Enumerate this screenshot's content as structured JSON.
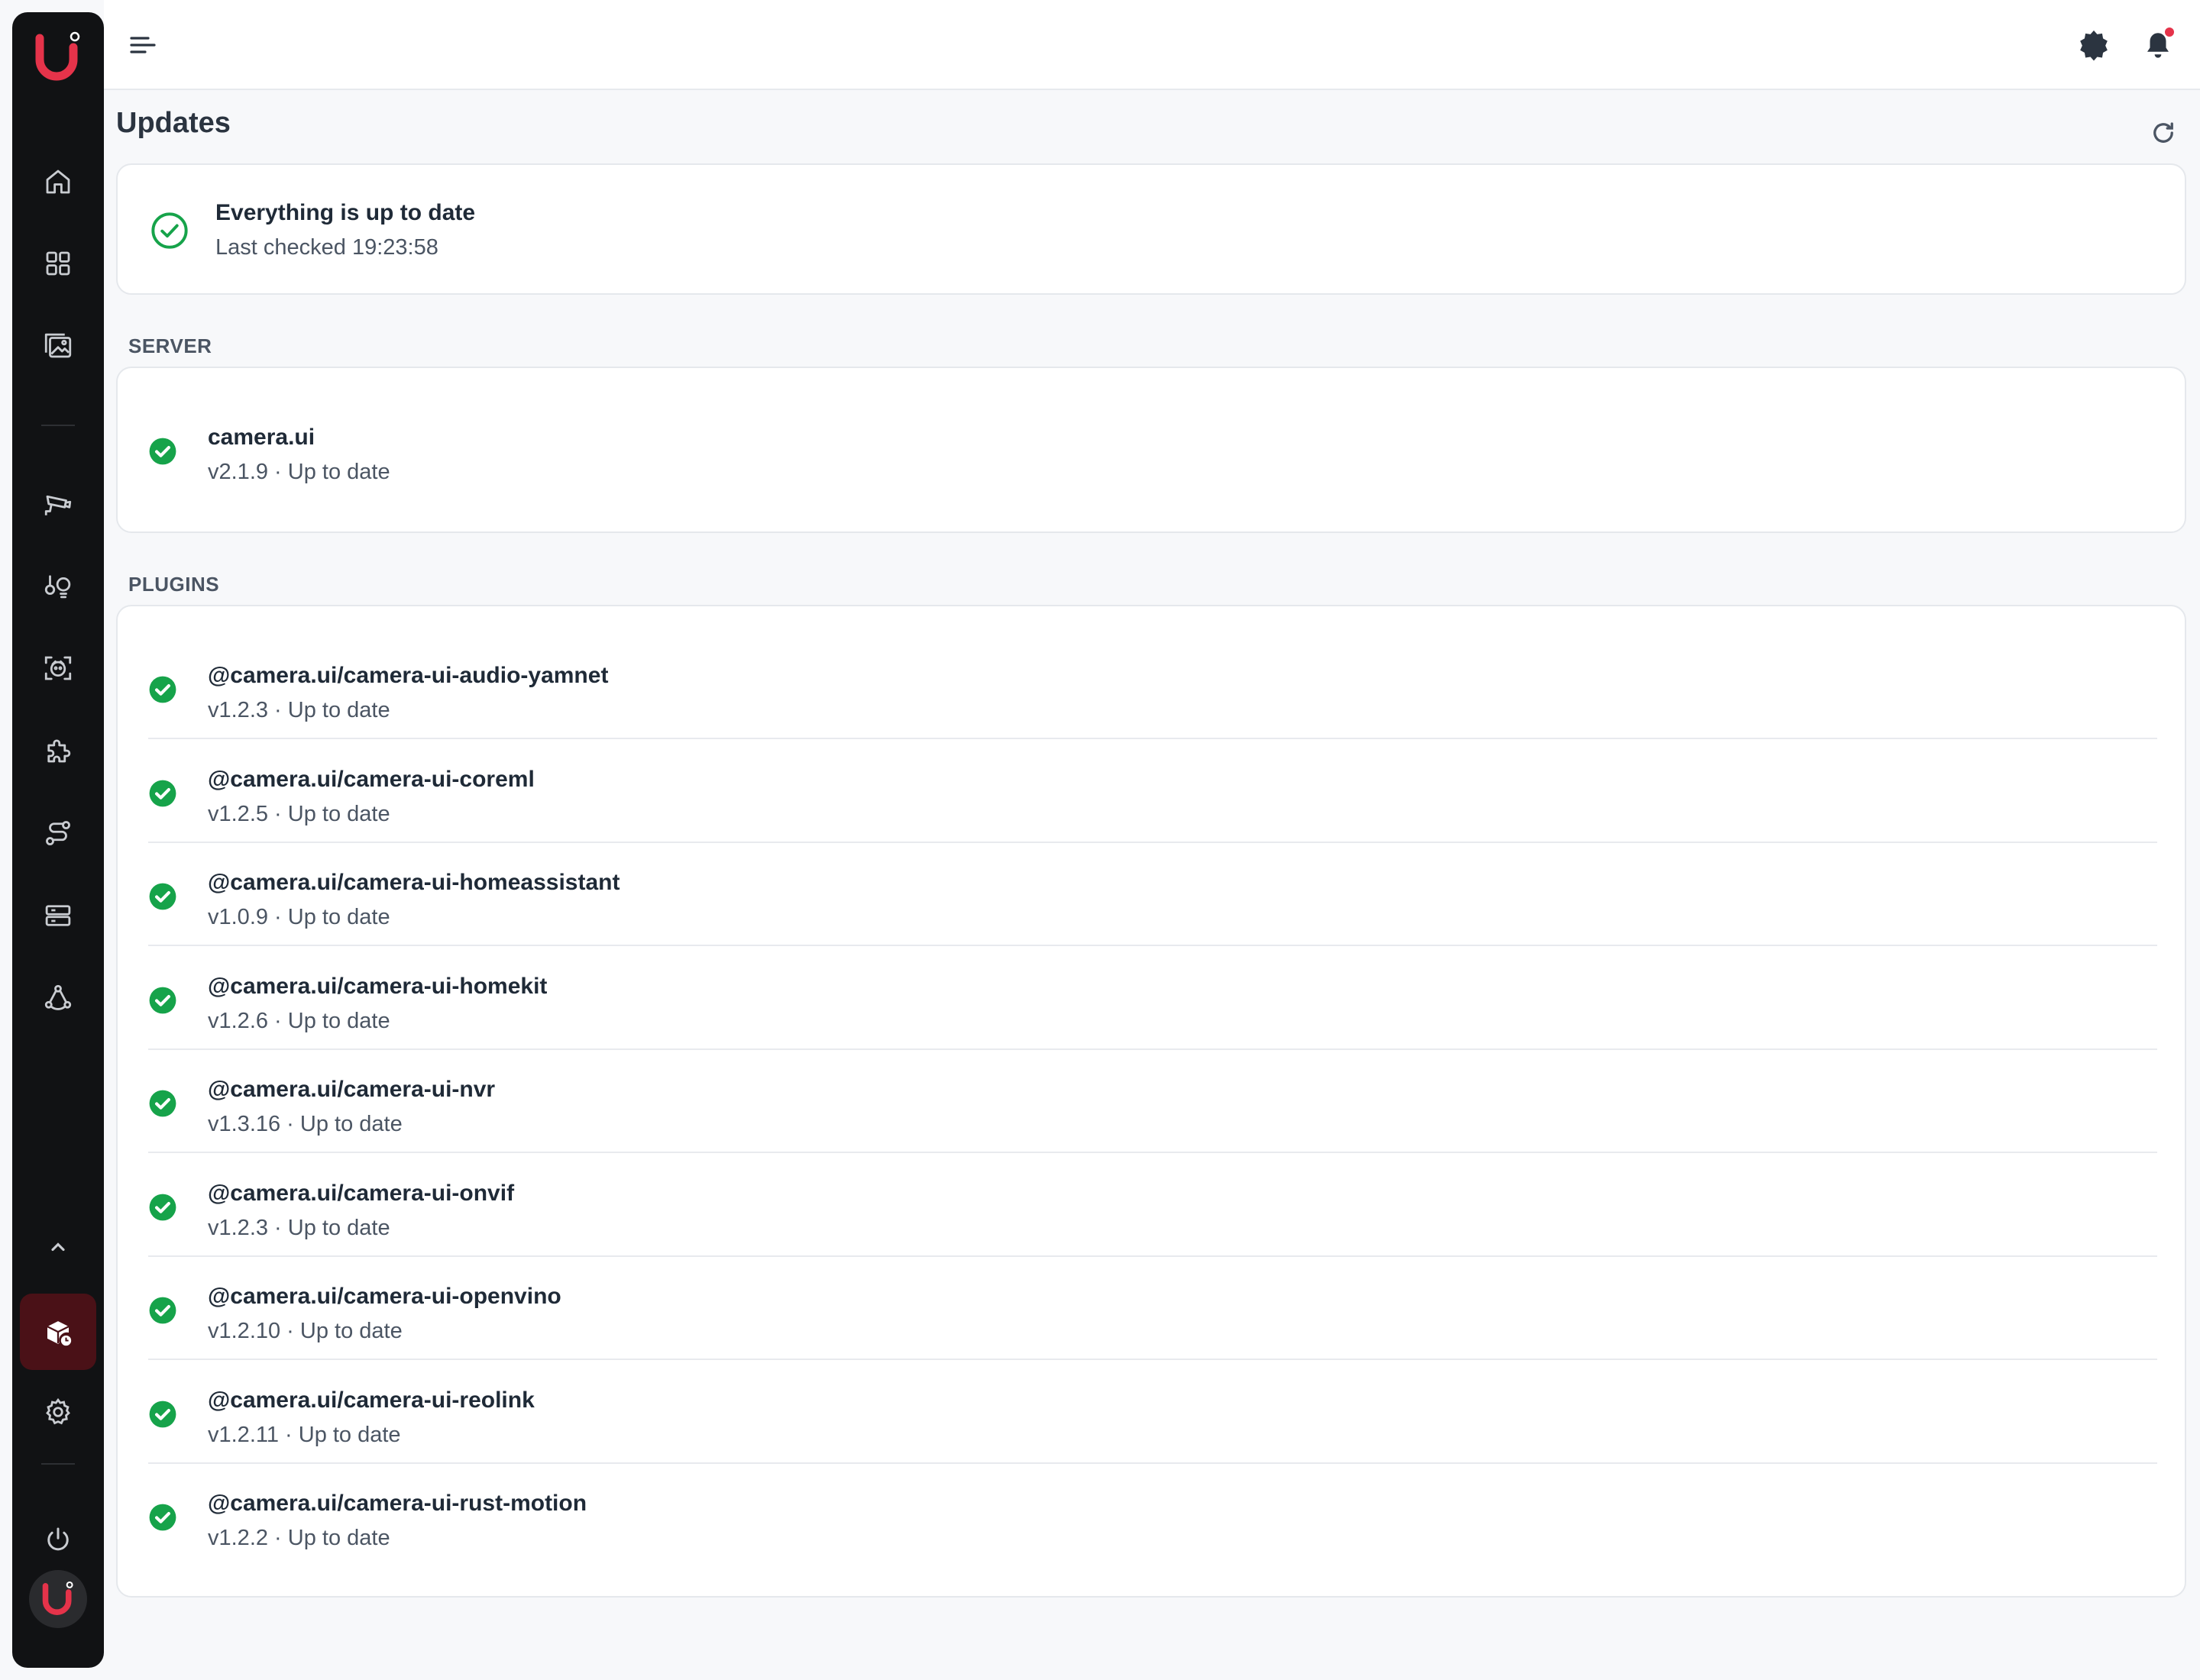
{
  "colors": {
    "sidebar_bg": "#111214",
    "brand": "#e5334a",
    "success": "#16a34a",
    "page_bg": "#f7f8fa"
  },
  "header": {
    "menu_icon": "menu-icon",
    "theme_icon": "theme-toggle-icon",
    "notifications_icon": "bell-icon"
  },
  "sidebar": {
    "items": [
      {
        "icon": "home-icon"
      },
      {
        "icon": "dashboard-grid-icon"
      },
      {
        "icon": "gallery-icon"
      },
      {
        "icon": "camera-icon"
      },
      {
        "icon": "automation-icon"
      },
      {
        "icon": "face-detection-icon"
      },
      {
        "icon": "plugins-puzzle-icon"
      },
      {
        "icon": "routes-icon"
      },
      {
        "icon": "storage-server-icon"
      },
      {
        "icon": "network-icon"
      },
      {
        "icon": "chevron-up-icon"
      },
      {
        "icon": "updates-package-icon",
        "active": true
      },
      {
        "icon": "settings-gear-icon"
      },
      {
        "icon": "power-icon"
      }
    ]
  },
  "main": {
    "title": "Updates",
    "status": {
      "title": "Everything is up to date",
      "last_checked": "Last checked 19:23:58"
    },
    "server": {
      "section_label": "SERVER",
      "items": [
        {
          "name": "camera.ui",
          "status": "v2.1.9 · Up to date"
        }
      ]
    },
    "plugins": {
      "section_label": "PLUGINS",
      "items": [
        {
          "name": "@camera.ui/camera-ui-audio-yamnet",
          "status": "v1.2.3 · Up to date"
        },
        {
          "name": "@camera.ui/camera-ui-coreml",
          "status": "v1.2.5 · Up to date"
        },
        {
          "name": "@camera.ui/camera-ui-homeassistant",
          "status": "v1.0.9 · Up to date"
        },
        {
          "name": "@camera.ui/camera-ui-homekit",
          "status": "v1.2.6 · Up to date"
        },
        {
          "name": "@camera.ui/camera-ui-nvr",
          "status": "v1.3.16 · Up to date"
        },
        {
          "name": "@camera.ui/camera-ui-onvif",
          "status": "v1.2.3 · Up to date"
        },
        {
          "name": "@camera.ui/camera-ui-openvino",
          "status": "v1.2.10 · Up to date"
        },
        {
          "name": "@camera.ui/camera-ui-reolink",
          "status": "v1.2.11 · Up to date"
        },
        {
          "name": "@camera.ui/camera-ui-rust-motion",
          "status": "v1.2.2 · Up to date"
        }
      ]
    }
  }
}
